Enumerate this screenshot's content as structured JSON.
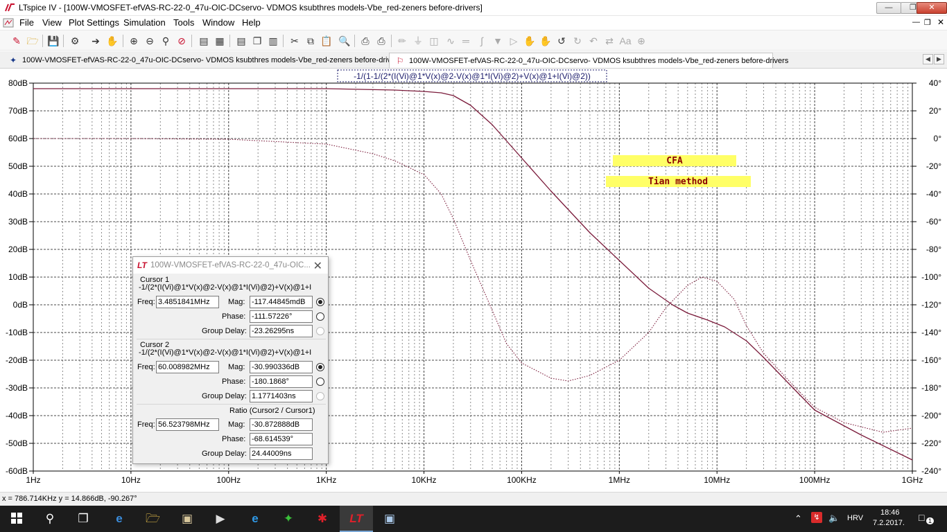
{
  "window": {
    "title": "LTspice IV - [100W-VMOSFET-efVAS-RC-22-0_47u-OIC-DCservo- VDMOS ksubthres models-Vbe_red-zeners before-drivers]"
  },
  "menu": {
    "items": [
      "File",
      "View",
      "Plot Settings",
      "Simulation",
      "Tools",
      "Window",
      "Help"
    ]
  },
  "tabs": [
    {
      "label": "100W-VMOSFET-efVAS-RC-22-0_47u-OIC-DCservo- VDMOS ksubthres models-Vbe_red-zeners before-drivers",
      "icon": "schematic-icon",
      "active": false
    },
    {
      "label": "100W-VMOSFET-efVAS-RC-22-0_47u-OIC-DCservo- VDMOS ksubthres models-Vbe_red-zeners before-drivers",
      "icon": "waveform-icon",
      "active": true
    }
  ],
  "plot": {
    "trace_expression": "-1/(1-1/(2*(I(Vi)@1*V(x)@2-V(x)@1*I(Vi)@2)+V(x)@1+I(Vi)@2))",
    "annotations": [
      "CFA",
      "Tian method"
    ],
    "colors": {
      "trace": "#7a1a3a",
      "grid": "#2a2a2a",
      "annotation_bg": "#ffff66",
      "annotation_text": "#8b0000"
    }
  },
  "chart_data": {
    "type": "line",
    "xscale": "log",
    "xlim": [
      1,
      1000000000
    ],
    "ylim": [
      -60,
      80
    ],
    "y2lim": [
      -240,
      40
    ],
    "x_ticks": [
      "1Hz",
      "10Hz",
      "100Hz",
      "1KHz",
      "10KHz",
      "100KHz",
      "1MHz",
      "10MHz",
      "100MHz",
      "1GHz"
    ],
    "y_ticks": [
      "80dB",
      "70dB",
      "60dB",
      "50dB",
      "40dB",
      "30dB",
      "20dB",
      "10dB",
      "0dB",
      "-10dB",
      "-20dB",
      "-30dB",
      "-40dB",
      "-50dB",
      "-60dB"
    ],
    "y2_ticks": [
      "40°",
      "20°",
      "0°",
      "-20°",
      "-40°",
      "-60°",
      "-80°",
      "-100°",
      "-120°",
      "-140°",
      "-160°",
      "-180°",
      "-200°",
      "-220°",
      "-240°"
    ],
    "grid": true,
    "series": [
      {
        "style": "solid",
        "axis": "left",
        "x": [
          1,
          10,
          100,
          1000,
          5000,
          10000,
          15000,
          20000,
          30000,
          50000,
          100000,
          200000,
          500000,
          1000000,
          2000000,
          3500000,
          5000000,
          8000000,
          12000000,
          20000000,
          30000000,
          60000000,
          100000000,
          300000000,
          1000000000
        ],
        "y": [
          78,
          78,
          78,
          78,
          77.5,
          77,
          76.5,
          75.5,
          72,
          65,
          53,
          41,
          26,
          16,
          6,
          0,
          -3,
          -5.5,
          -8,
          -13,
          -19,
          -30,
          -38,
          -47,
          -56
        ]
      },
      {
        "style": "dotted",
        "axis": "right",
        "x": [
          1,
          10,
          100,
          1000,
          3000,
          5000,
          10000,
          15000,
          20000,
          30000,
          50000,
          70000,
          100000,
          200000,
          300000,
          500000,
          1000000,
          2000000,
          3000000,
          5000000,
          7000000,
          10000000,
          15000000,
          20000000,
          30000000,
          60000000,
          100000000,
          200000000,
          500000000,
          1000000000
        ],
        "y": [
          0,
          0,
          -0.5,
          -4,
          -11,
          -16,
          -26,
          -40,
          -58,
          -88,
          -124,
          -148,
          -162,
          -173,
          -175,
          -171,
          -160,
          -140,
          -122,
          -106,
          -100,
          -103,
          -116,
          -135,
          -155,
          -178,
          -194,
          -205,
          -212,
          -209
        ]
      }
    ]
  },
  "cursor_dialog": {
    "title": "100W-VMOSFET-efVAS-RC-22-0_47u-OIC...",
    "cursor1": {
      "heading": "Cursor 1",
      "expr": "-1/(2*(I(Vi)@1*V(x)@2-V(x)@1*I(Vi)@2)+V(x)@1+I(Vi",
      "freq_label": "Freq:",
      "freq": "3.4851841MHz",
      "mag_label": "Mag:",
      "mag": "-117.44845mdB",
      "phase_label": "Phase:",
      "phase": "-111.57226°",
      "gd_label": "Group Delay:",
      "gd": "-23.26295ns"
    },
    "cursor2": {
      "heading": "Cursor 2",
      "expr": "-1/(2*(I(Vi)@1*V(x)@2-V(x)@1*I(Vi)@2)+V(x)@1+I(Vi",
      "freq_label": "Freq:",
      "freq": "60.008982MHz",
      "mag_label": "Mag:",
      "mag": "-30.990336dB",
      "phase_label": "Phase:",
      "phase": "-180.1868°",
      "gd_label": "Group Delay:",
      "gd": "1.1771403ns"
    },
    "ratio": {
      "heading": "Ratio (Cursor2 / Cursor1)",
      "freq_label": "Freq:",
      "freq": "56.523798MHz",
      "mag_label": "Mag:",
      "mag": "-30.872888dB",
      "phase_label": "Phase:",
      "phase": "-68.614539°",
      "gd_label": "Group Delay:",
      "gd": "24.44009ns"
    }
  },
  "status": {
    "text": "x = 786.714KHz   y = 14.866dB, -90.267°"
  },
  "taskbar": {
    "language": "HRV",
    "time": "18:46",
    "date": "7.2.2017.",
    "notifications": "1"
  }
}
